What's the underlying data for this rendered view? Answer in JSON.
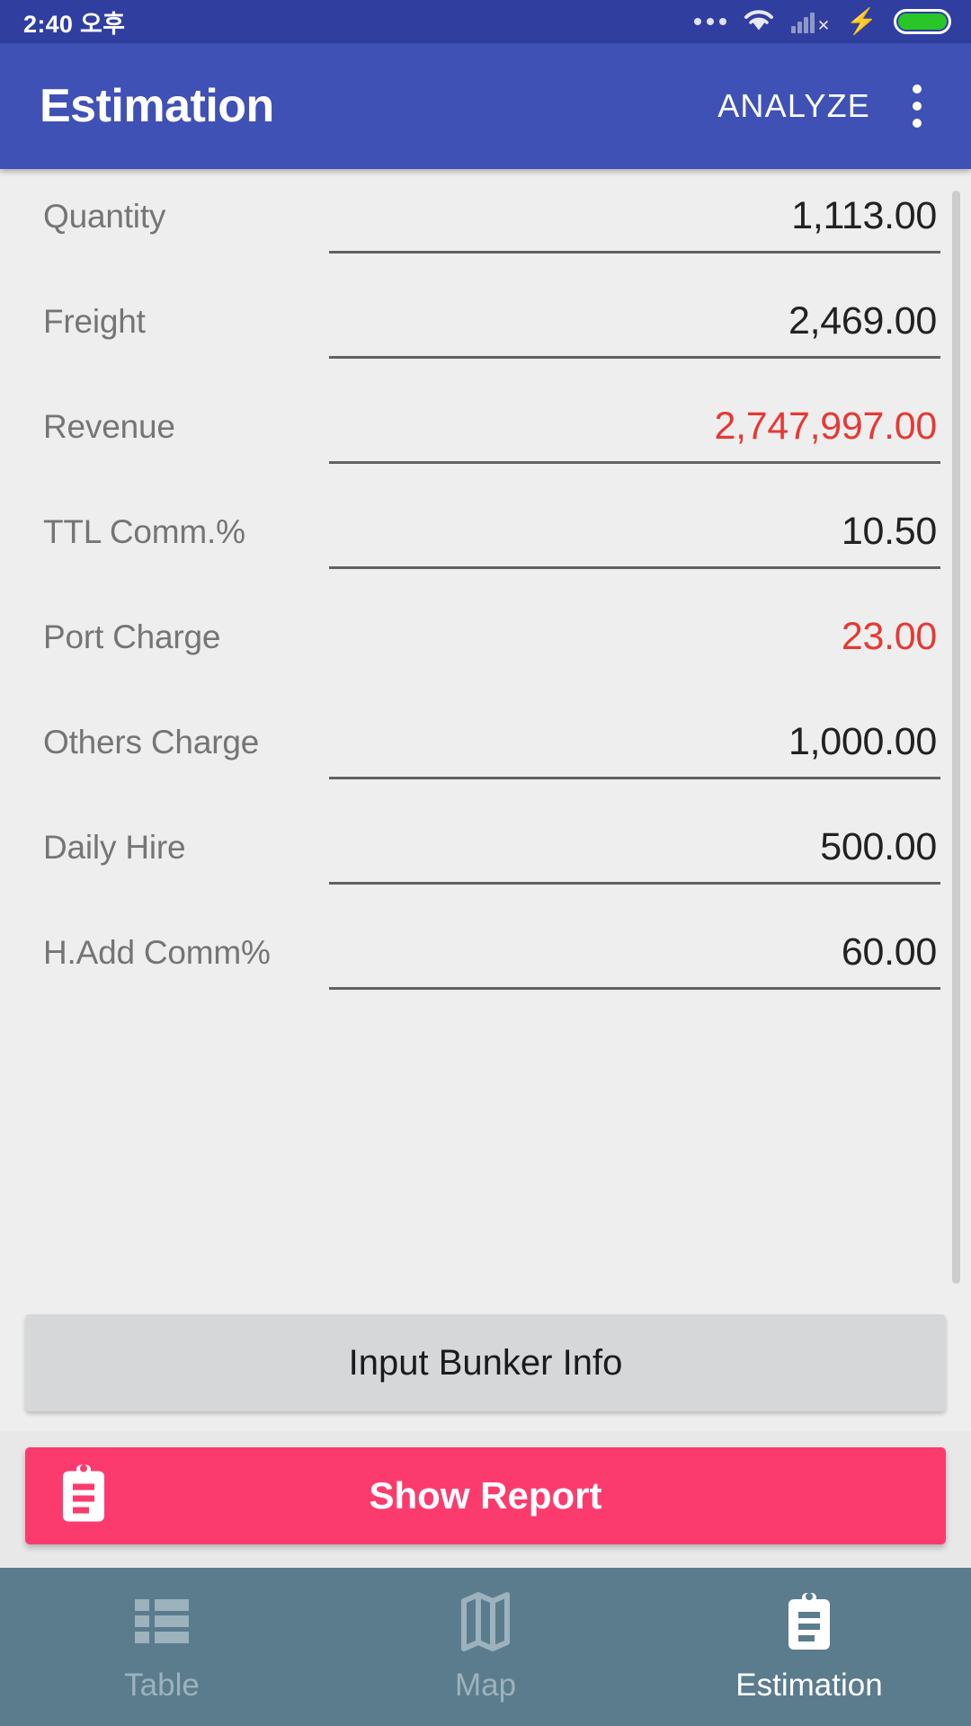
{
  "status_bar": {
    "clock": "2:40 오후",
    "icons": [
      "more-dots-icon",
      "wifi-icon",
      "cellular-no-sim-icon",
      "charging-bolt-icon",
      "battery-icon"
    ],
    "battery_color": "#28c628"
  },
  "app_bar": {
    "title": "Estimation",
    "analyze_label": "ANALYZE",
    "overflow_label": "overflow-menu",
    "background": "#3f51b5"
  },
  "form": {
    "rows": [
      {
        "label": "Quantity",
        "value": "1,113.00",
        "negative": false,
        "underline": true
      },
      {
        "label": "Freight",
        "value": "2,469.00",
        "negative": false,
        "underline": true
      },
      {
        "label": "Revenue",
        "value": "2,747,997.00",
        "negative": true,
        "underline": true
      },
      {
        "label": "TTL Comm.%",
        "value": "10.50",
        "negative": false,
        "underline": true
      },
      {
        "label": "Port Charge",
        "value": "23.00",
        "negative": true,
        "underline": false
      },
      {
        "label": "Others Charge",
        "value": "1,000.00",
        "negative": false,
        "underline": true
      },
      {
        "label": "Daily Hire",
        "value": "500.00",
        "negative": false,
        "underline": true
      },
      {
        "label": "H.Add Comm%",
        "value": "60.00",
        "negative": false,
        "underline": true
      }
    ],
    "negative_color": "#e53935"
  },
  "bunker_button": {
    "label": "Input Bunker Info"
  },
  "report_button": {
    "label": "Show Report",
    "icon": "clipboard-icon",
    "color": "#fb3b6e"
  },
  "bottom_nav": {
    "items": [
      {
        "label": "Table",
        "icon": "table-list-icon",
        "active": false
      },
      {
        "label": "Map",
        "icon": "map-icon",
        "active": false
      },
      {
        "label": "Estimation",
        "icon": "clipboard-icon",
        "active": true
      }
    ],
    "background": "#5b7c8d"
  }
}
